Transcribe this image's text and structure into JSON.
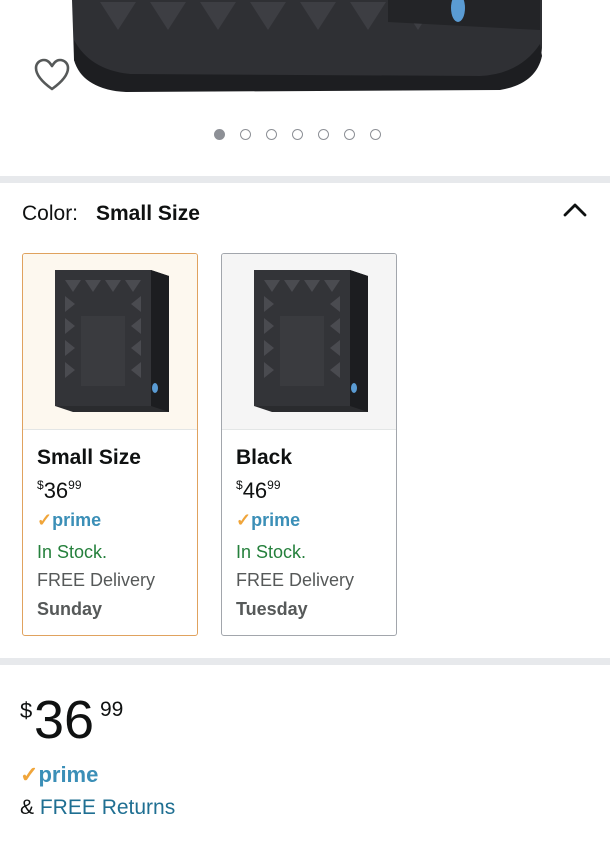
{
  "gallery": {
    "image_count": 7,
    "active_index": 0
  },
  "color_selector": {
    "label": "Color:",
    "selected_value": "Small Size"
  },
  "variants": [
    {
      "name": "Small Size",
      "price_currency": "$",
      "price_whole": "36",
      "price_fraction": "99",
      "prime_check": "✓",
      "prime": "prime",
      "stock": "In Stock.",
      "delivery": "FREE Delivery",
      "delivery_day": "Sunday",
      "selected": true
    },
    {
      "name": "Black",
      "price_currency": "$",
      "price_whole": "46",
      "price_fraction": "99",
      "prime_check": "✓",
      "prime": "prime",
      "stock": "In Stock.",
      "delivery": "FREE Delivery",
      "delivery_day": "Tuesday",
      "selected": false
    }
  ],
  "price": {
    "currency": "$",
    "whole": "36",
    "fraction": "99"
  },
  "prime_badge": {
    "check": "✓",
    "text": "prime"
  },
  "returns": {
    "prefix": "&",
    "link": "FREE Returns"
  },
  "colors": {
    "prime_blue": "#3b8fb7",
    "prime_check_orange": "#f0a53a",
    "in_stock_green": "#25803c",
    "selected_border": "#e0a25e",
    "link_blue": "#1f6f92"
  },
  "icons": [
    "heart-icon",
    "chevron-up-icon"
  ]
}
